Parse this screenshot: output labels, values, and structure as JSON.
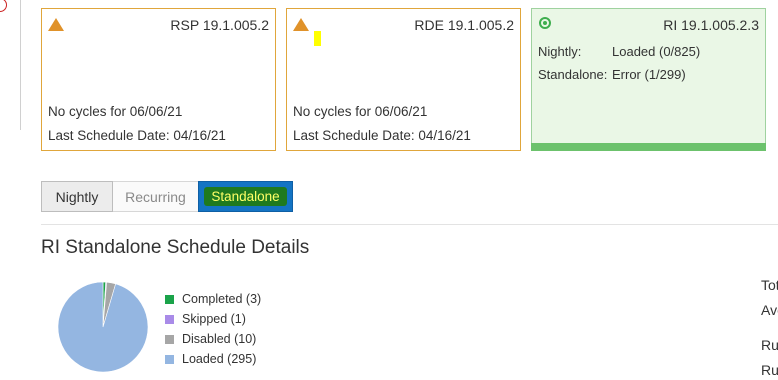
{
  "cards": [
    {
      "title": "RSP 19.1.005.2",
      "line1": "No cycles for 06/06/21",
      "line2": "Last Schedule Date: 04/16/21"
    },
    {
      "title": "RDE 19.1.005.2",
      "line1": "No cycles for 06/06/21",
      "line2": "Last Schedule Date: 04/16/21"
    },
    {
      "title": "RI 19.1.005.2.3",
      "nightly_label": "Nightly:",
      "nightly_value": "Loaded (0/825)",
      "standalone_label": "Standalone:",
      "standalone_value": "Error (1/299)"
    }
  ],
  "tabs": {
    "nightly": "Nightly",
    "recurring": "Recurring",
    "standalone": "Standalone",
    "selected": "Standalone"
  },
  "section_title": "RI Standalone Schedule Details",
  "chart_data": {
    "type": "pie",
    "categories": [
      "Completed",
      "Skipped",
      "Disabled",
      "Loaded"
    ],
    "values": [
      3,
      1,
      10,
      295
    ],
    "colors": [
      "#1aa34a",
      "#a98be8",
      "#a6a6a6",
      "#94b6e1"
    ],
    "legend": [
      "Completed (3)",
      "Skipped (1)",
      "Disabled (10)",
      "Loaded (295)"
    ],
    "legend_position": "right"
  },
  "right_truncated": [
    "Tot",
    "Ave",
    "Ru",
    "Ru"
  ],
  "icons": {
    "warning": "warning-triangle-icon",
    "ok": "radio-check-icon"
  }
}
